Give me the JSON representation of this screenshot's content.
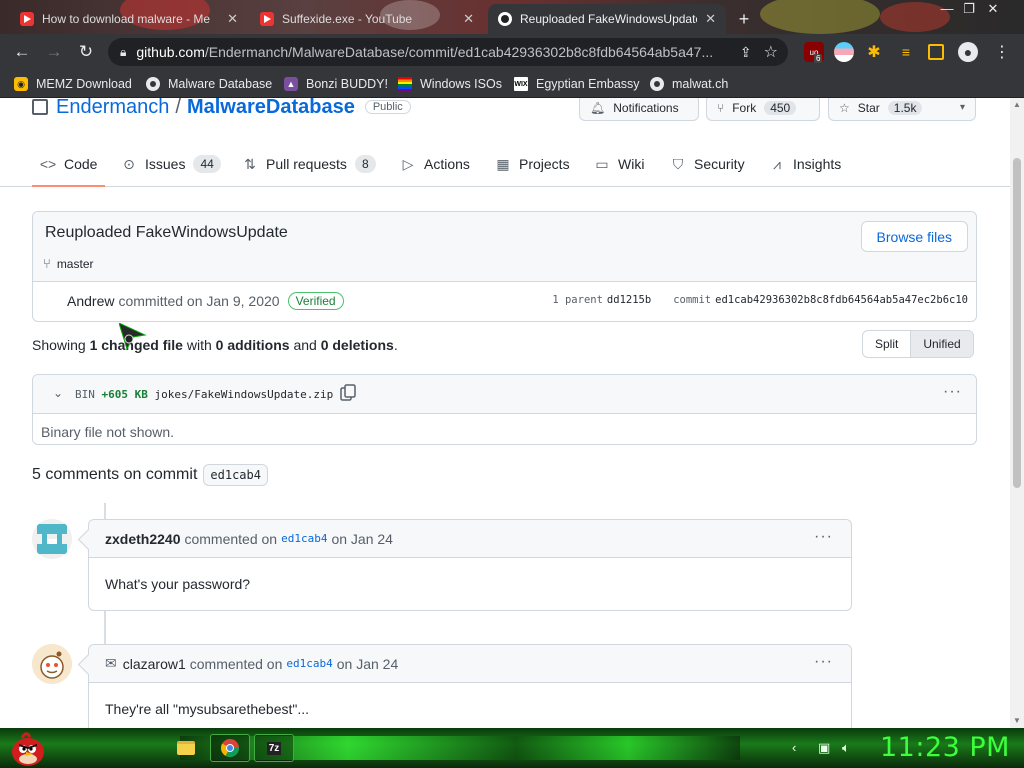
{
  "browser": {
    "tabs": [
      {
        "title": "How to download malware - Me",
        "icon": "youtube-icon"
      },
      {
        "title": "Suffexide.exe - YouTube",
        "icon": "youtube-icon"
      },
      {
        "title": "Reuploaded FakeWindowsUpdate",
        "icon": "github-icon",
        "active": true
      }
    ],
    "url_host": "github.com",
    "url_path": "/Endermanch/MalwareDatabase/commit/ed1cab42936302b8c8fdb64564ab5a47...",
    "extension_badge": "6",
    "bookmarks": [
      {
        "label": "MEMZ Download",
        "icon": "memz-icon"
      },
      {
        "label": "Malware Database",
        "icon": "github-icon"
      },
      {
        "label": "Bonzi BUDDY!",
        "icon": "bonzi-icon"
      },
      {
        "label": "Windows ISOs",
        "icon": "rainbow-flag-icon"
      },
      {
        "label": "Egyptian Embassy",
        "icon": "wix-icon"
      },
      {
        "label": "malwat.ch",
        "icon": "github-icon"
      }
    ]
  },
  "repo": {
    "owner": "Endermanch",
    "separator": "/",
    "name": "MalwareDatabase",
    "visibility": "Public",
    "notifications_label": "Notifications",
    "fork_label": "Fork",
    "fork_count": "450",
    "star_label": "Star",
    "star_count": "1.5k"
  },
  "nav": [
    {
      "label": "Code",
      "count": null,
      "selected": true
    },
    {
      "label": "Issues",
      "count": "44"
    },
    {
      "label": "Pull requests",
      "count": "8"
    },
    {
      "label": "Actions",
      "count": null
    },
    {
      "label": "Projects",
      "count": null
    },
    {
      "label": "Wiki",
      "count": null
    },
    {
      "label": "Security",
      "count": null
    },
    {
      "label": "Insights",
      "count": null
    }
  ],
  "commit": {
    "title": "Reuploaded FakeWindowsUpdate",
    "branch": "master",
    "browse_label": "Browse files",
    "author": "Andrew",
    "committed_text": "committed on Jan 9, 2020",
    "verified": "Verified",
    "parent_label": "1 parent",
    "parent_sha": "dd1215b",
    "commit_label": "commit",
    "commit_sha": "ed1cab42936302b8c8fdb64564ab5a47ec2b6c10"
  },
  "summary": {
    "prefix": "Showing",
    "files": "1 changed file",
    "with": "with",
    "additions": "0 additions",
    "and": "and",
    "deletions": "0 deletions",
    "suffix": ".",
    "split_label": "Split",
    "unified_label": "Unified"
  },
  "file": {
    "bin_label": "BIN",
    "size_change": "+605 KB",
    "path": "jokes/FakeWindowsUpdate.zip",
    "body": "Binary file not shown."
  },
  "comments": {
    "heading": "5 comments on commit",
    "sha": "ed1cab4",
    "items": [
      {
        "user": "zxdeth2240",
        "action": "commented on",
        "sha": "ed1cab4",
        "date": "on Jan 24",
        "body": "What's your password?"
      },
      {
        "user": "clazarow1",
        "action": "commented on",
        "sha": "ed1cab4",
        "date": "on Jan 24",
        "body": "They're all \"mysubsarethebest\"..."
      }
    ]
  },
  "taskbar": {
    "clock": "11:23 PM"
  }
}
